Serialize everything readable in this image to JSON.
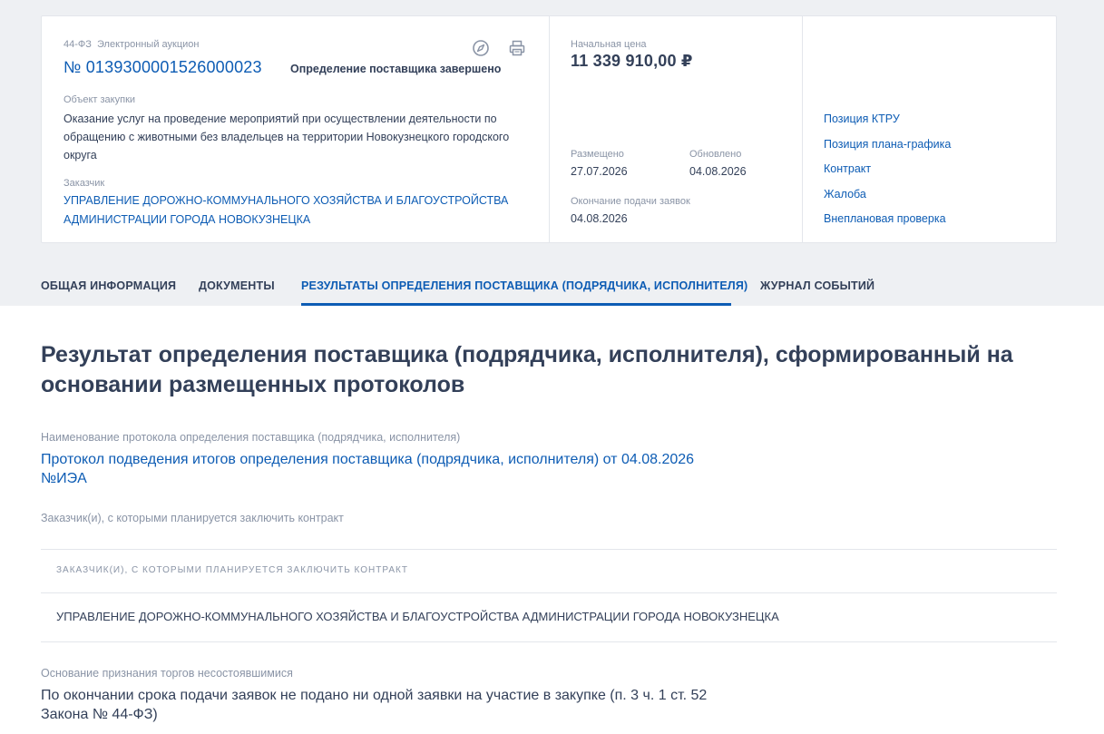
{
  "header": {
    "law_type": "44-ФЗ",
    "procedure_type": "Электронный аукцион",
    "reg_number": "№ 0139300001526000023",
    "status": "Определение поставщика завершено",
    "object_label": "Объект закупки",
    "object_text": "Оказание услуг на проведение мероприятий при осуществлении деятельности по обращению с животными без владельцев на территории Новокузнецкого городского округа",
    "customer_label": "Заказчик",
    "customer_name": "Управление дорожно-коммунального хозяйства и благоустройства администрации города Новокузнецка"
  },
  "price_block": {
    "price_label": "Начальная цена",
    "price_value": "11 339 910,00 ₽",
    "placed_label": "Размещено",
    "placed_date": "27.07.2026",
    "updated_label": "Обновлено",
    "updated_date": "04.08.2026",
    "deadline_label": "Окончание подачи заявок",
    "deadline_date": "04.08.2026"
  },
  "side_links": [
    "Позиция КТРУ",
    "Позиция плана-графика",
    "Контракт",
    "Жалоба",
    "Внеплановая проверка"
  ],
  "tabs": [
    {
      "label": "Общая информация",
      "active": false
    },
    {
      "label": "Документы",
      "active": false
    },
    {
      "label": "Результаты определения поставщика (подрядчика, исполнителя)",
      "active": true
    },
    {
      "label": "Журнал событий",
      "active": false
    }
  ],
  "main": {
    "title": "Результат определения поставщика (подрядчика, исполнителя), сформированный на основании размещенных протоколов",
    "protocol_label": "Наименование протокола определения поставщика (подрядчика, исполнителя)",
    "protocol_link": "Протокол подведения итогов определения поставщика (подрядчика, исполнителя) от 04.08.2026 №ИЭА",
    "customers_label": "Заказчик(и), с которыми планируется заключить контракт",
    "table": {
      "header": "Заказчик(и), с которыми планируется заключить контракт",
      "rows": [
        "Управление дорожно-коммунального хозяйства и благоустройства администрации города Новокузнецка"
      ]
    },
    "reason_label": "Основание признания торгов несостоявшимися",
    "reason_text": "По окончании срока подачи заявок не подано ни одной заявки на участие в закупке (п. 3 ч. 1 ст. 52 Закона № 44-ФЗ)"
  },
  "icons": {
    "compass": "compass-icon",
    "print": "printer-icon"
  },
  "colors": {
    "link": "#0d5cb4",
    "text": "#334059",
    "muted": "#8a94a6",
    "background_top": "#eef0f3"
  }
}
